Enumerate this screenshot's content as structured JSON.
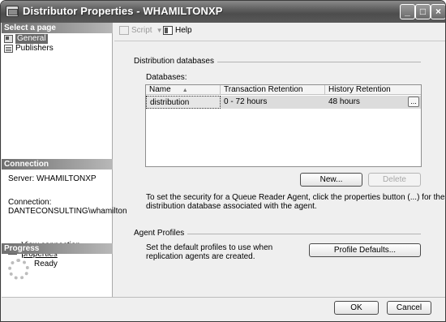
{
  "window": {
    "title": "Distributor Properties - WHAMILTONXP",
    "minimize_label": "_",
    "maximize_label": "□",
    "close_label": "×"
  },
  "left_pane": {
    "select_page_header": "Select a page",
    "pages": [
      {
        "label": "General",
        "icon": "general-page-icon",
        "selected": true
      },
      {
        "label": "Publishers",
        "icon": "publishers-page-icon",
        "selected": false
      }
    ],
    "connection_header": "Connection",
    "server_line": "Server: WHAMILTONXP",
    "connection_label": "Connection:",
    "connection_value": "DANTECONSULTING\\whamilton",
    "view_connection_link": "View connection properties",
    "progress_header": "Progress",
    "progress_status": "Ready"
  },
  "toolbar": {
    "script_label": "Script",
    "script_caret": "▼",
    "help_label": "Help"
  },
  "main": {
    "distribution_group_label": "Distribution databases",
    "databases_label": "Databases:",
    "columns": [
      "Name",
      "Transaction Retention",
      "History Retention"
    ],
    "sort_indicator": "▲",
    "rows": [
      {
        "name": "distribution",
        "transaction_retention": "0 - 72 hours",
        "history_retention": "48 hours",
        "button": "..."
      }
    ],
    "new_button": "New...",
    "delete_button": "Delete",
    "security_note_line1": "To set the security for a Queue Reader Agent, click the properties button (...) for the",
    "security_note_line2": "distribution database associated with the agent.",
    "agent_profiles_group_label": "Agent Profiles",
    "agent_profiles_text_line1": "Set the default profiles to use when",
    "agent_profiles_text_line2": "replication agents are created.",
    "profile_defaults_button": "Profile Defaults..."
  },
  "footer": {
    "ok_button": "OK",
    "cancel_button": "Cancel"
  }
}
